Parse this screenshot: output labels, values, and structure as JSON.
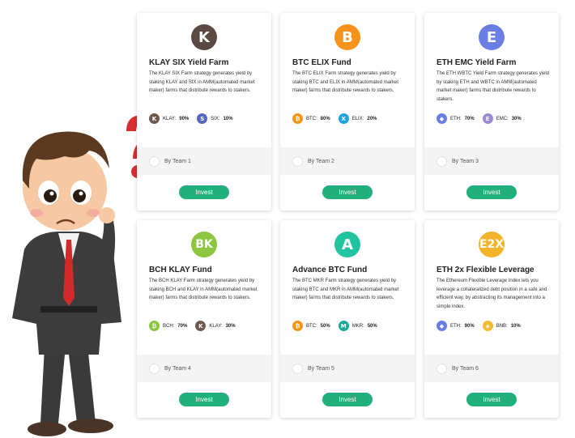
{
  "cards": [
    {
      "logo": "K",
      "logo_color": "#5b4a41",
      "title": "KLAY SIX Yield Farm",
      "desc": "The KLAY SIX Farm strategy generates yield by staking KLAY and SIX in AMM(automated market maker) farms that distribute rewards to stakers.",
      "tokens": [
        {
          "icon": "klay-icon",
          "glyph": "K",
          "color": "#6d5a4f",
          "label": "KLAY:",
          "pct": "90%"
        },
        {
          "icon": "six-icon",
          "glyph": "S",
          "color": "#5467c4",
          "label": "SIX:",
          "pct": "10%"
        }
      ],
      "team": "By Team 1",
      "invest": "Invest"
    },
    {
      "logo": "B",
      "logo_color": "#f7931a",
      "title": "BTC ELIX Fund",
      "desc": "The BTC ELIX Farm strategy generates yield by staking BTC and ELIX in AMM(automated market maker) farms that distribute rewards to stakers.",
      "tokens": [
        {
          "icon": "btc-icon",
          "glyph": "₿",
          "color": "#f7931a",
          "label": "BTC:",
          "pct": "80%"
        },
        {
          "icon": "elix-icon",
          "glyph": "X",
          "color": "#1fa2e0",
          "label": "ELIX:",
          "pct": "20%"
        }
      ],
      "team": "By Team 2",
      "invest": "Invest"
    },
    {
      "logo": "E",
      "logo_color": "#6a7ee4",
      "title": "ETH EMC Yield Farm",
      "desc": "The ETH WBTC Yield Farm strategy generates yield by staking ETH and WBTC in AMM(automated market maker) farms that distribute rewards to stakers.",
      "tokens": [
        {
          "icon": "eth-icon",
          "glyph": "◆",
          "color": "#6a7ee4",
          "label": "ETH:",
          "pct": "70%"
        },
        {
          "icon": "emc-icon",
          "glyph": "E",
          "color": "#9b8ad6",
          "label": "EMC:",
          "pct": "30%"
        }
      ],
      "team": "By Team 3",
      "invest": "Invest"
    },
    {
      "logo": "BK",
      "logo_color": "#8cc63f",
      "title": "BCH KLAY Fund",
      "desc": "The BCH KLAY Farm strategy generates yield by staking BCH and KLAY in AMM(automated market maker) farms that distribute rewards to stakers.",
      "tokens": [
        {
          "icon": "bch-icon",
          "glyph": "₿",
          "color": "#8cc63f",
          "label": "BCH:",
          "pct": "70%"
        },
        {
          "icon": "klay-icon",
          "glyph": "K",
          "color": "#6d5a4f",
          "label": "KLAY:",
          "pct": "30%"
        }
      ],
      "team": "By Team 4",
      "invest": "Invest"
    },
    {
      "logo": "A",
      "logo_color": "#22c3a0",
      "title": "Advance BTC Fund",
      "desc": "The BTC MKR Farm strategy generates yield by staking BTC and MKR in AMM(automated market maker) farms that distribute rewards to stakers.",
      "tokens": [
        {
          "icon": "btc-icon",
          "glyph": "₿",
          "color": "#f7931a",
          "label": "BTC:",
          "pct": "50%"
        },
        {
          "icon": "mkr-icon",
          "glyph": "M",
          "color": "#1aab9b",
          "label": "MKR:",
          "pct": "50%"
        }
      ],
      "team": "By Team 5",
      "invest": "Invest"
    },
    {
      "logo": "E2X",
      "logo_color": "#f3b32a",
      "title": "ETH 2x Flexible Leverage",
      "desc": "The Ethereum Flexible Leverage Index lets you leverage a collateralized debt position in a safe and efficient way, by abstracting its management into a simple index.",
      "tokens": [
        {
          "icon": "eth-icon",
          "glyph": "◆",
          "color": "#6a7ee4",
          "label": "ETH:",
          "pct": "90%"
        },
        {
          "icon": "bnb-icon",
          "glyph": "◈",
          "color": "#f3ba2f",
          "label": "BNB:",
          "pct": "10%"
        }
      ],
      "team": "By Team 6",
      "invest": "Invest"
    }
  ]
}
